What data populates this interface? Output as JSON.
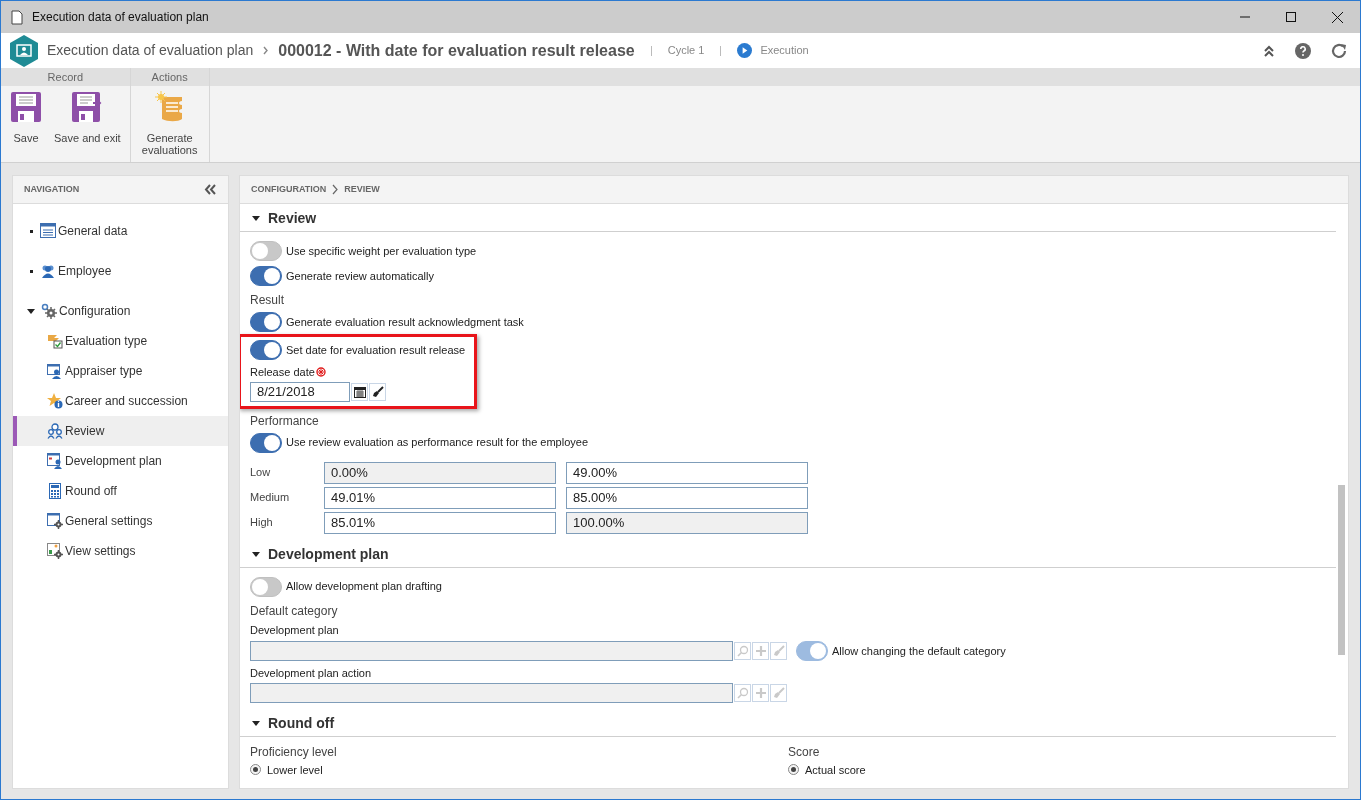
{
  "window": {
    "title": "Execution data of evaluation plan"
  },
  "header": {
    "breadcrumb": "Execution data of evaluation plan",
    "title": "000012 - With date for evaluation result release",
    "cycle": "Cycle 1",
    "status": "Execution"
  },
  "ribbon": {
    "groups": [
      {
        "label": "Record",
        "buttons": [
          {
            "label": "Save",
            "kind": "save"
          },
          {
            "label": "Save and exit",
            "kind": "save_exit"
          }
        ]
      },
      {
        "label": "Actions",
        "buttons": [
          {
            "label": "Generate evaluations",
            "kind": "generate"
          }
        ]
      }
    ]
  },
  "navigation": {
    "title": "NAVIGATION",
    "items": [
      {
        "label": "General data",
        "kind": "list",
        "selected": false
      },
      {
        "label": "Employee",
        "kind": "people",
        "selected": false
      },
      {
        "label": "Configuration",
        "kind": "gears",
        "selected": false,
        "expanded": true,
        "children": [
          {
            "label": "Evaluation type",
            "kind": "evaltype",
            "selected": false
          },
          {
            "label": "Appraiser type",
            "kind": "appraiser",
            "selected": false
          },
          {
            "label": "Career and succession",
            "kind": "star",
            "selected": false
          },
          {
            "label": "Review",
            "kind": "review",
            "selected": true
          },
          {
            "label": "Development plan",
            "kind": "devplan",
            "selected": false
          },
          {
            "label": "Round off",
            "kind": "calculator",
            "selected": false
          },
          {
            "label": "General settings",
            "kind": "settings",
            "selected": false
          },
          {
            "label": "View settings",
            "kind": "viewsettings",
            "selected": false
          }
        ]
      }
    ]
  },
  "content": {
    "breadcrumb": [
      "CONFIGURATION",
      "REVIEW"
    ],
    "sections": [
      {
        "title": "Review",
        "expanded": true,
        "rows": [
          {
            "kind": "toggle",
            "label": "Use specific weight per evaluation type",
            "on": false
          },
          {
            "kind": "toggle",
            "label": "Generate review automatically",
            "on": true
          },
          {
            "kind": "subheading",
            "label": "Result"
          },
          {
            "kind": "toggle",
            "label": "Generate evaluation result acknowledgment task",
            "on": true
          },
          {
            "kind": "highlight",
            "rows": [
              {
                "kind": "toggle",
                "label": "Set date for evaluation result release",
                "on": true
              },
              {
                "kind": "date",
                "label": "Release date",
                "required": true,
                "value": "8/21/2018"
              }
            ]
          },
          {
            "kind": "subheading",
            "label": "Performance"
          },
          {
            "kind": "toggle",
            "label": "Use review evaluation as performance result for the employee",
            "on": true
          },
          {
            "kind": "ranges",
            "rows": [
              {
                "label": "Low",
                "from": {
                  "value": "0.00%",
                  "disabled": true
                },
                "to": {
                  "value": "49.00%",
                  "disabled": false
                }
              },
              {
                "label": "Medium",
                "from": {
                  "value": "49.01%",
                  "disabled": false
                },
                "to": {
                  "value": "85.00%",
                  "disabled": false
                }
              },
              {
                "label": "High",
                "from": {
                  "value": "85.01%",
                  "disabled": false
                },
                "to": {
                  "value": "100.00%",
                  "disabled": true
                }
              }
            ]
          }
        ]
      },
      {
        "title": "Development plan",
        "expanded": true,
        "rows": [
          {
            "kind": "toggle",
            "label": "Allow development plan drafting",
            "on": false
          },
          {
            "kind": "subheading",
            "label": "Default category"
          },
          {
            "kind": "lookup",
            "label": "Development plan",
            "disabled": true,
            "toggle": {
              "label": "Allow changing the default category",
              "on": true,
              "disabled": true
            }
          },
          {
            "kind": "lookup",
            "label": "Development plan action",
            "disabled": true
          }
        ]
      },
      {
        "title": "Round off",
        "expanded": true,
        "rows": [
          {
            "kind": "radios",
            "columns": [
              {
                "heading": "Proficiency level",
                "options": [
                  {
                    "label": "Lower level",
                    "selected": true
                  }
                ]
              },
              {
                "heading": "Score",
                "options": [
                  {
                    "label": "Actual score",
                    "selected": true
                  }
                ]
              }
            ]
          }
        ]
      }
    ]
  }
}
